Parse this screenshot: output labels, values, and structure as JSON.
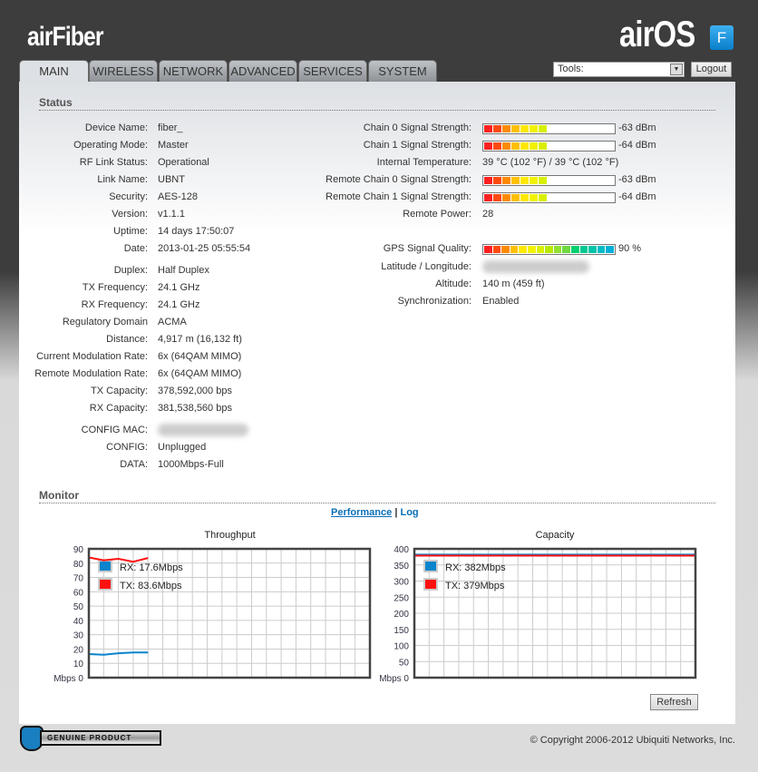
{
  "header": {
    "brand_logo": "airFiber",
    "os_logo": "airOS",
    "os_badge": "F"
  },
  "tabs": [
    {
      "label": "MAIN",
      "active": true
    },
    {
      "label": "WIRELESS"
    },
    {
      "label": "NETWORK"
    },
    {
      "label": "ADVANCED"
    },
    {
      "label": "SERVICES"
    },
    {
      "label": "SYSTEM"
    }
  ],
  "tools": {
    "label": "Tools:"
  },
  "logout_label": "Logout",
  "status": {
    "title": "Status",
    "left": [
      {
        "label": "Device Name:",
        "value": "fiber_"
      },
      {
        "label": "Operating Mode:",
        "value": "Master"
      },
      {
        "label": "RF Link Status:",
        "value": "Operational"
      },
      {
        "label": "Link Name:",
        "value": "UBNT"
      },
      {
        "label": "Security:",
        "value": "AES-128"
      },
      {
        "label": "Version:",
        "value": "v1.1.1"
      },
      {
        "label": "Uptime:",
        "value": "14 days 17:50:07"
      },
      {
        "label": "Date:",
        "value": "2013-01-25 05:55:54"
      },
      {
        "label": "Duplex:",
        "value": "Half Duplex"
      },
      {
        "label": "TX Frequency:",
        "value": "24.1 GHz"
      },
      {
        "label": "RX Frequency:",
        "value": "24.1 GHz"
      },
      {
        "label": "Regulatory Domain",
        "value": "ACMA"
      },
      {
        "label": "Distance:",
        "value": "4,917 m (16,132 ft)"
      },
      {
        "label": "Current Modulation Rate:",
        "value": "6x (64QAM MIMO)"
      },
      {
        "label": "Remote Modulation Rate:",
        "value": "6x (64QAM MIMO)"
      },
      {
        "label": "TX Capacity:",
        "value": "378,592,000 bps"
      },
      {
        "label": "RX Capacity:",
        "value": "381,538,560 bps"
      },
      {
        "label": "CONFIG MAC:",
        "value": null
      },
      {
        "label": "CONFIG:",
        "value": "Unplugged"
      },
      {
        "label": "DATA:",
        "value": "1000Mbps-Full"
      }
    ],
    "right": [
      {
        "label": "Chain 0 Signal Strength:",
        "value": "-63 dBm",
        "bar_segments": 7
      },
      {
        "label": "Chain 1 Signal Strength:",
        "value": "-64 dBm",
        "bar_segments": 7
      },
      {
        "label": "Internal Temperature:",
        "value": "39 °C (102 °F) / 39 °C (102 °F)"
      },
      {
        "label": "Remote Chain 0 Signal Strength:",
        "value": "-63 dBm",
        "bar_segments": 7
      },
      {
        "label": "Remote Chain 1 Signal Strength:",
        "value": "-64 dBm",
        "bar_segments": 7
      },
      {
        "label": "Remote Power:",
        "value": "28"
      },
      {
        "label": "GPS Signal Quality:",
        "value": "90 %",
        "bar_segments": 15
      },
      {
        "label": "Latitude / Longitude:",
        "value": null
      },
      {
        "label": "Altitude:",
        "value": "140 m (459 ft)"
      },
      {
        "label": "Synchronization:",
        "value": "Enabled"
      }
    ]
  },
  "monitor": {
    "title": "Monitor",
    "link_performance": "Performance",
    "separator": "|",
    "link_log": "Log",
    "refresh_label": "Refresh"
  },
  "colors": {
    "rx": "#0a84cc",
    "tx": "#ff1010",
    "seg": [
      "#ff2020",
      "#ff4a10",
      "#ff8a00",
      "#ffc000",
      "#ffe800",
      "#f2f200",
      "#d8f000",
      "#b8e800",
      "#90e030",
      "#70d840",
      "#00d070",
      "#00c890",
      "#00c4a8",
      "#00bcc4",
      "#00b0d8"
    ]
  },
  "chart_data": [
    {
      "type": "line",
      "title": "Throughput",
      "ylabel": "Mbps",
      "ylim": [
        0,
        90
      ],
      "yticks": [
        0,
        10,
        20,
        30,
        40,
        50,
        60,
        70,
        80,
        90
      ],
      "x": [
        0,
        1,
        2,
        3,
        4
      ],
      "xmax": 19,
      "series": [
        {
          "name": "RX",
          "legend": "RX: 17.6Mbps",
          "values": [
            16.5,
            16,
            17,
            17.6,
            17.6
          ]
        },
        {
          "name": "TX",
          "legend": "TX: 83.6Mbps",
          "values": [
            84,
            82,
            83,
            81,
            83.6
          ]
        }
      ]
    },
    {
      "type": "line",
      "title": "Capacity",
      "ylabel": "Mbps",
      "ylim": [
        0,
        400
      ],
      "yticks": [
        0,
        50,
        100,
        150,
        200,
        250,
        300,
        350,
        400
      ],
      "x": [
        0,
        19
      ],
      "xmax": 19,
      "series": [
        {
          "name": "RX",
          "legend": "RX: 382Mbps",
          "values": [
            382,
            382
          ]
        },
        {
          "name": "TX",
          "legend": "TX: 379Mbps",
          "values": [
            379,
            379
          ]
        }
      ]
    }
  ],
  "footer": {
    "badge": "GENUINE PRODUCT",
    "copyright": "© Copyright 2006-2012 Ubiquiti Networks, Inc."
  }
}
